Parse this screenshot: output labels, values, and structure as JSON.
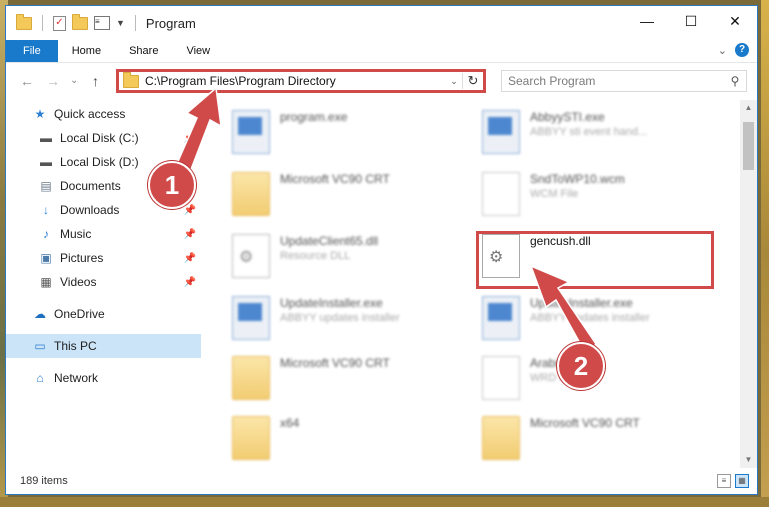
{
  "window": {
    "title": "Program",
    "minimize": "—",
    "maximize": "☐",
    "close": "✕"
  },
  "ribbon": {
    "tabs": [
      "File",
      "Home",
      "Share",
      "View"
    ],
    "collapse": "⌄",
    "help": "?"
  },
  "navbar": {
    "back": "←",
    "forward": "→",
    "recent": "⌄",
    "up": "↑",
    "address": "C:\\Program Files\\Program Directory",
    "address_dropdown": "⌄",
    "refresh": "↻",
    "search_placeholder": "Search Program",
    "search_icon": "⚲"
  },
  "sidebar": {
    "items": [
      {
        "label": "Quick access",
        "icon": "star-icon",
        "glyph": "★"
      },
      {
        "label": "Local Disk (C:)",
        "icon": "drive-icon",
        "glyph": "▬"
      },
      {
        "label": "Local Disk (D:)",
        "icon": "drive-icon",
        "glyph": "▬"
      },
      {
        "label": "Documents",
        "icon": "documents-icon",
        "glyph": "▤"
      },
      {
        "label": "Downloads",
        "icon": "downloads-icon",
        "glyph": "↓"
      },
      {
        "label": "Music",
        "icon": "music-icon",
        "glyph": "♪"
      },
      {
        "label": "Pictures",
        "icon": "pictures-icon",
        "glyph": "▣"
      },
      {
        "label": "Videos",
        "icon": "videos-icon",
        "glyph": "▦"
      },
      {
        "label": "OneDrive",
        "icon": "cloud-icon",
        "glyph": "☁"
      },
      {
        "label": "This PC",
        "icon": "computer-icon",
        "glyph": "▭"
      },
      {
        "label": "Network",
        "icon": "network-icon",
        "glyph": "⌂"
      }
    ],
    "pin": "📌"
  },
  "files": {
    "left": [
      {
        "name": "program.exe",
        "sub": ""
      },
      {
        "name": "Microsoft VC90 CRT",
        "sub": ""
      },
      {
        "name": "UpdateClient65.dll",
        "sub": "Resource DLL"
      },
      {
        "name": "UpdateInstaller.exe",
        "sub": "ABBYY updates installer"
      },
      {
        "name": "Microsoft VC90 CRT",
        "sub": ""
      },
      {
        "name": "x64",
        "sub": ""
      }
    ],
    "right": [
      {
        "name": "AbbyySTI.exe",
        "sub": "ABBYY sti event hand..."
      },
      {
        "name": "SndToWP10.wcm",
        "sub": "WCM File"
      },
      {
        "name": "gencush.dll",
        "sub": ""
      },
      {
        "name": "UpdateInstaller.exe",
        "sub": "ABBYY updates installer"
      },
      {
        "name": "Arabic",
        "sub": "WRD File"
      },
      {
        "name": "Microsoft VC90 CRT",
        "sub": ""
      }
    ]
  },
  "status": {
    "count": "189 items"
  },
  "callouts": [
    "1",
    "2"
  ],
  "colors": {
    "accent": "#1979ca",
    "highlight": "#d14a4a"
  }
}
